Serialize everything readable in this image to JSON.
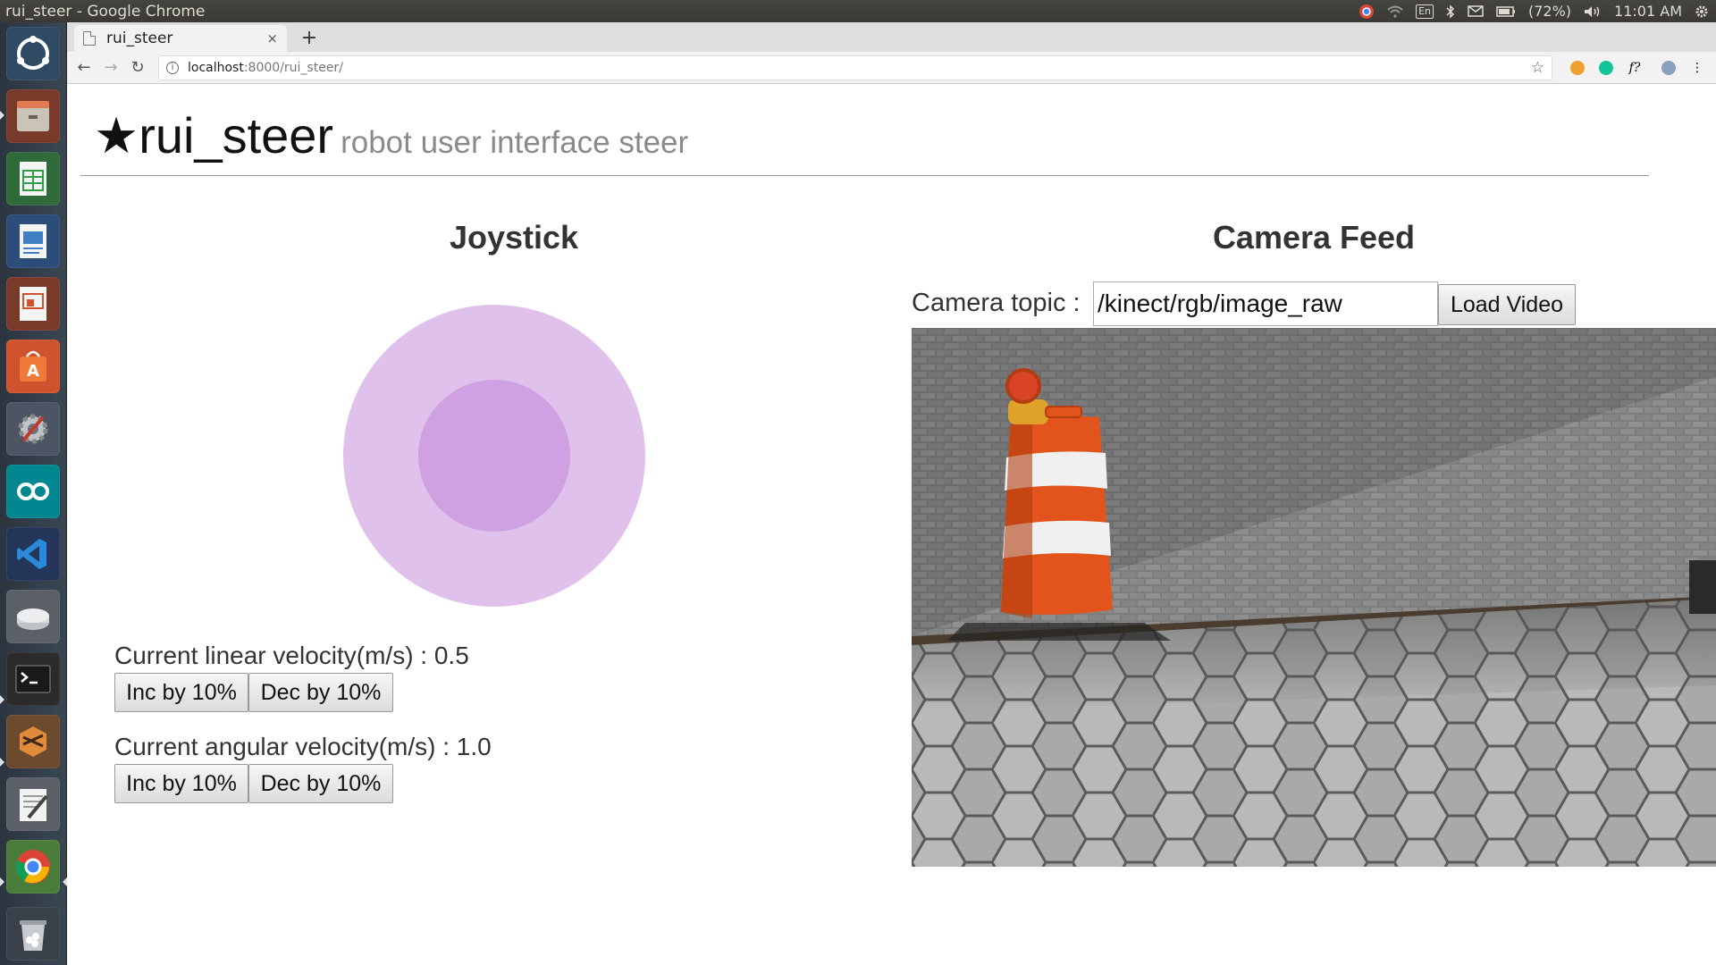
{
  "os": {
    "window_title": "rui_steer - Google Chrome",
    "keyboard": "En",
    "battery": "(72%)",
    "clock": "11:01 AM"
  },
  "browser": {
    "tab_title": "rui_steer",
    "tab_close": "×",
    "new_tab": "+",
    "url_host": "localhost",
    "url_path": ":8000/rui_steer/",
    "ext_font": "f?"
  },
  "page": {
    "brand_star": "★",
    "brand": "rui_steer",
    "subtitle": "robot user interface steer",
    "joystick_title": "Joystick",
    "camera_title": "Camera Feed",
    "linear_label": "Current linear velocity(m/s) : 0.5",
    "angular_label": "Current angular velocity(m/s) : 1.0",
    "inc_label": "Inc by 10%",
    "dec_label": "Dec by 10%",
    "camera_topic_label": "Camera topic :",
    "camera_topic_value": "/kinect/rgb/image_raw",
    "load_video_label": "Load Video"
  },
  "launcher_icons": [
    "ubuntu-dash-icon",
    "files-icon",
    "spreadsheet-icon",
    "writer-icon",
    "impress-icon",
    "software-center-icon",
    "system-settings-icon",
    "arduino-icon",
    "vscode-icon",
    "disk-icon",
    "terminal-icon",
    "sublime-icon",
    "text-editor-icon",
    "chrome-icon",
    "trash-icon"
  ],
  "colors": {
    "joystick_outer": "#dfc1ec",
    "joystick_inner": "#cfa1e2"
  }
}
